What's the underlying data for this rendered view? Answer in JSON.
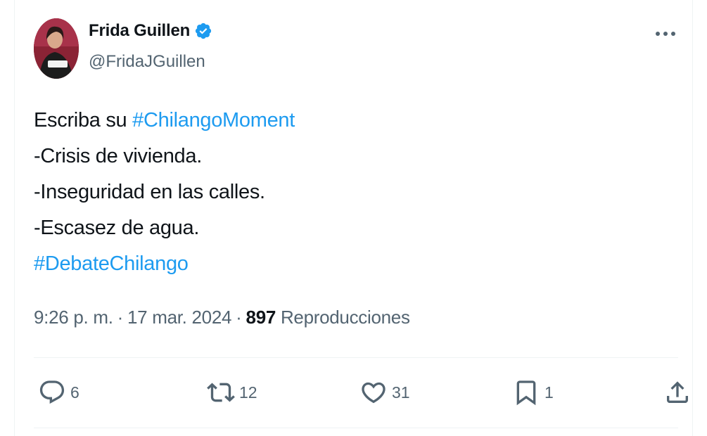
{
  "author": {
    "name": "Frida Guillen",
    "handle": "@FridaJGuillen",
    "verified": true,
    "verified_color": "#1d9bf0"
  },
  "tweet": {
    "lines": [
      {
        "text": "Escriba su ",
        "hashtag": "#ChilangoMoment"
      },
      {
        "text": "-Crisis de vivienda."
      },
      {
        "text": "-Inseguridad en las calles."
      },
      {
        "text": "-Escasez de agua."
      },
      {
        "text": "",
        "hashtag": "#DebateChilango"
      }
    ]
  },
  "meta": {
    "time": "9:26 p. m.",
    "separator": "·",
    "date": "17 mar. 2024",
    "views_count": "897",
    "views_label": "Reproducciones"
  },
  "actions": {
    "reply_count": "6",
    "retweet_count": "12",
    "like_count": "31",
    "bookmark_count": "1"
  },
  "icons": {
    "more": "more-horizontal-icon",
    "reply": "reply-icon",
    "retweet": "retweet-icon",
    "like": "heart-icon",
    "bookmark": "bookmark-icon",
    "share": "share-icon"
  },
  "colors": {
    "text": "#0f1419",
    "secondary": "#536471",
    "link": "#1d9bf0",
    "border": "#eff3f4"
  }
}
